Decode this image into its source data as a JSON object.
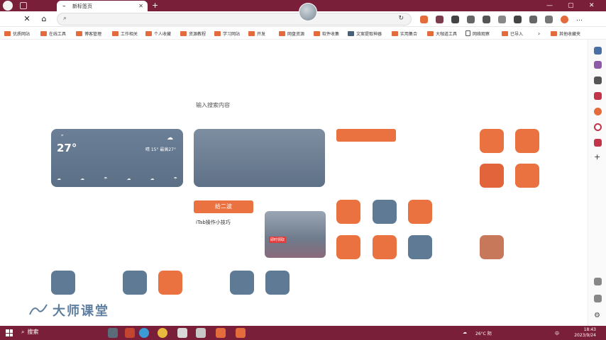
{
  "browser": {
    "tab_title": "新标签页",
    "address_value": "",
    "win_minimize": "—",
    "win_close": "✕"
  },
  "bookmarks": [
    "优质网站",
    "在线工具",
    "博客管理",
    "工作相关",
    "个人收藏",
    "资源教程",
    "学习网站",
    "开发",
    "网盘资源",
    "软件收集",
    "文案提取神器",
    "实用集合",
    "大咖道工具",
    "网络观察",
    "已导入",
    "其他收藏夹"
  ],
  "search": {
    "label": "输入搜索内容"
  },
  "weather": {
    "temp": "27°",
    "range": "晴 15° 最高27°"
  },
  "button": {
    "label": "给二波"
  },
  "tip": {
    "label": "iTab操作小技巧"
  },
  "promo": {
    "badge": "即时领取"
  },
  "watermark": {
    "text": "大师课堂"
  },
  "taskbar": {
    "search": "搜索",
    "weather": "26°C 阴",
    "ime": "中",
    "time": "18:43",
    "date": "2023/9/24"
  },
  "colors": {
    "accent": "#ea7240",
    "tile_blue": "#5f7a94",
    "chrome": "#7a1f3a"
  }
}
